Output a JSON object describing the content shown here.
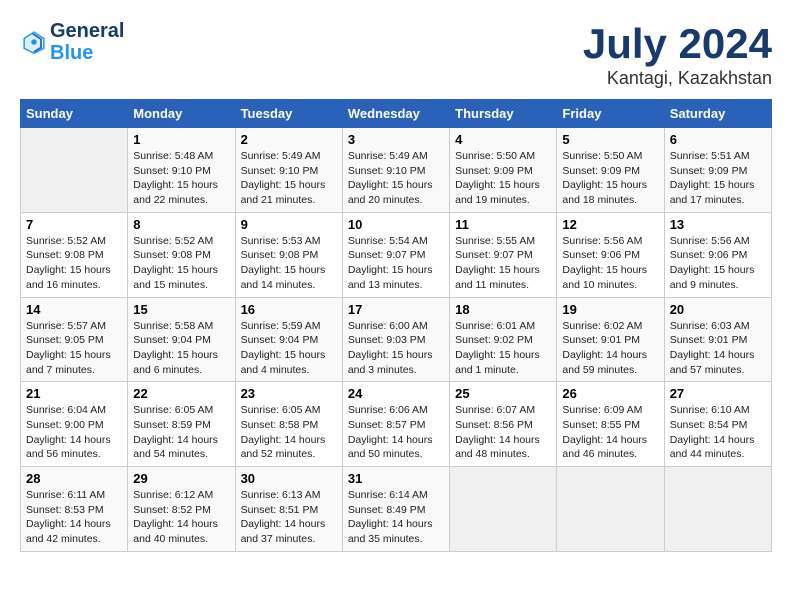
{
  "header": {
    "logo_line1": "General",
    "logo_line2": "Blue",
    "title": "July 2024",
    "subtitle": "Kantagi, Kazakhstan"
  },
  "weekdays": [
    "Sunday",
    "Monday",
    "Tuesday",
    "Wednesday",
    "Thursday",
    "Friday",
    "Saturday"
  ],
  "weeks": [
    [
      {
        "day": "",
        "info": ""
      },
      {
        "day": "1",
        "info": "Sunrise: 5:48 AM\nSunset: 9:10 PM\nDaylight: 15 hours\nand 22 minutes."
      },
      {
        "day": "2",
        "info": "Sunrise: 5:49 AM\nSunset: 9:10 PM\nDaylight: 15 hours\nand 21 minutes."
      },
      {
        "day": "3",
        "info": "Sunrise: 5:49 AM\nSunset: 9:10 PM\nDaylight: 15 hours\nand 20 minutes."
      },
      {
        "day": "4",
        "info": "Sunrise: 5:50 AM\nSunset: 9:09 PM\nDaylight: 15 hours\nand 19 minutes."
      },
      {
        "day": "5",
        "info": "Sunrise: 5:50 AM\nSunset: 9:09 PM\nDaylight: 15 hours\nand 18 minutes."
      },
      {
        "day": "6",
        "info": "Sunrise: 5:51 AM\nSunset: 9:09 PM\nDaylight: 15 hours\nand 17 minutes."
      }
    ],
    [
      {
        "day": "7",
        "info": "Sunrise: 5:52 AM\nSunset: 9:08 PM\nDaylight: 15 hours\nand 16 minutes."
      },
      {
        "day": "8",
        "info": "Sunrise: 5:52 AM\nSunset: 9:08 PM\nDaylight: 15 hours\nand 15 minutes."
      },
      {
        "day": "9",
        "info": "Sunrise: 5:53 AM\nSunset: 9:08 PM\nDaylight: 15 hours\nand 14 minutes."
      },
      {
        "day": "10",
        "info": "Sunrise: 5:54 AM\nSunset: 9:07 PM\nDaylight: 15 hours\nand 13 minutes."
      },
      {
        "day": "11",
        "info": "Sunrise: 5:55 AM\nSunset: 9:07 PM\nDaylight: 15 hours\nand 11 minutes."
      },
      {
        "day": "12",
        "info": "Sunrise: 5:56 AM\nSunset: 9:06 PM\nDaylight: 15 hours\nand 10 minutes."
      },
      {
        "day": "13",
        "info": "Sunrise: 5:56 AM\nSunset: 9:06 PM\nDaylight: 15 hours\nand 9 minutes."
      }
    ],
    [
      {
        "day": "14",
        "info": "Sunrise: 5:57 AM\nSunset: 9:05 PM\nDaylight: 15 hours\nand 7 minutes."
      },
      {
        "day": "15",
        "info": "Sunrise: 5:58 AM\nSunset: 9:04 PM\nDaylight: 15 hours\nand 6 minutes."
      },
      {
        "day": "16",
        "info": "Sunrise: 5:59 AM\nSunset: 9:04 PM\nDaylight: 15 hours\nand 4 minutes."
      },
      {
        "day": "17",
        "info": "Sunrise: 6:00 AM\nSunset: 9:03 PM\nDaylight: 15 hours\nand 3 minutes."
      },
      {
        "day": "18",
        "info": "Sunrise: 6:01 AM\nSunset: 9:02 PM\nDaylight: 15 hours\nand 1 minute."
      },
      {
        "day": "19",
        "info": "Sunrise: 6:02 AM\nSunset: 9:01 PM\nDaylight: 14 hours\nand 59 minutes."
      },
      {
        "day": "20",
        "info": "Sunrise: 6:03 AM\nSunset: 9:01 PM\nDaylight: 14 hours\nand 57 minutes."
      }
    ],
    [
      {
        "day": "21",
        "info": "Sunrise: 6:04 AM\nSunset: 9:00 PM\nDaylight: 14 hours\nand 56 minutes."
      },
      {
        "day": "22",
        "info": "Sunrise: 6:05 AM\nSunset: 8:59 PM\nDaylight: 14 hours\nand 54 minutes."
      },
      {
        "day": "23",
        "info": "Sunrise: 6:05 AM\nSunset: 8:58 PM\nDaylight: 14 hours\nand 52 minutes."
      },
      {
        "day": "24",
        "info": "Sunrise: 6:06 AM\nSunset: 8:57 PM\nDaylight: 14 hours\nand 50 minutes."
      },
      {
        "day": "25",
        "info": "Sunrise: 6:07 AM\nSunset: 8:56 PM\nDaylight: 14 hours\nand 48 minutes."
      },
      {
        "day": "26",
        "info": "Sunrise: 6:09 AM\nSunset: 8:55 PM\nDaylight: 14 hours\nand 46 minutes."
      },
      {
        "day": "27",
        "info": "Sunrise: 6:10 AM\nSunset: 8:54 PM\nDaylight: 14 hours\nand 44 minutes."
      }
    ],
    [
      {
        "day": "28",
        "info": "Sunrise: 6:11 AM\nSunset: 8:53 PM\nDaylight: 14 hours\nand 42 minutes."
      },
      {
        "day": "29",
        "info": "Sunrise: 6:12 AM\nSunset: 8:52 PM\nDaylight: 14 hours\nand 40 minutes."
      },
      {
        "day": "30",
        "info": "Sunrise: 6:13 AM\nSunset: 8:51 PM\nDaylight: 14 hours\nand 37 minutes."
      },
      {
        "day": "31",
        "info": "Sunrise: 6:14 AM\nSunset: 8:49 PM\nDaylight: 14 hours\nand 35 minutes."
      },
      {
        "day": "",
        "info": ""
      },
      {
        "day": "",
        "info": ""
      },
      {
        "day": "",
        "info": ""
      }
    ]
  ]
}
